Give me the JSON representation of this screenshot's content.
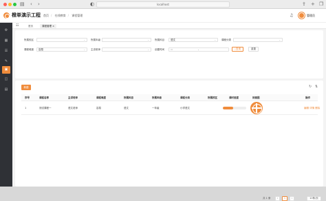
{
  "browser": {
    "url": "localhost",
    "nav_icons": [
      "sidebar-toggle",
      "chevron-left",
      "chevron-right"
    ],
    "right_icons": [
      "share",
      "new-tab",
      "tabs"
    ]
  },
  "app": {
    "title": "橙单演示工程",
    "breadcrumb": [
      "首页",
      "在线教育",
      "课程管理"
    ],
    "user_name": "管理员",
    "accent": "#f08c3c"
  },
  "sidebar": {
    "items": [
      "gear",
      "apps",
      "list",
      "edit",
      "chart",
      "bag",
      "doc"
    ],
    "active_index": 4
  },
  "tabs": {
    "home_label": "首页",
    "active_label": "课程管理 ×"
  },
  "filter": {
    "fields": [
      {
        "label": "所属校区",
        "value": ""
      },
      {
        "label": "所属年级",
        "value": ""
      },
      {
        "label": "所属科目",
        "value": "语文"
      },
      {
        "label": "课程分类",
        "value": ""
      },
      {
        "label": "课程难度",
        "value": "容易"
      },
      {
        "label": "主讲老师",
        "value": ""
      }
    ],
    "date_label": "创建时间",
    "date_sep": "-",
    "search_label": "查询",
    "reset_label": "重置"
  },
  "table": {
    "add_label": "新建",
    "columns": [
      "序号",
      "课程名称",
      "主讲老师",
      "课程难度",
      "所属科目",
      "所属年级",
      "课程分类",
      "所属校区",
      "课时进度",
      "封面图",
      "操作"
    ],
    "rows": [
      {
        "index": "1",
        "name": "测试课程一",
        "teacher": "语文老师",
        "difficulty": "容易",
        "subject": "语文",
        "grade": "一年级",
        "category": "小学语文",
        "campus": "",
        "progress": 0.45,
        "actions": "编辑  详情  删除"
      }
    ]
  },
  "pagination": {
    "total": "共 1 条",
    "current_page": "1",
    "page_size": "10条/页"
  }
}
